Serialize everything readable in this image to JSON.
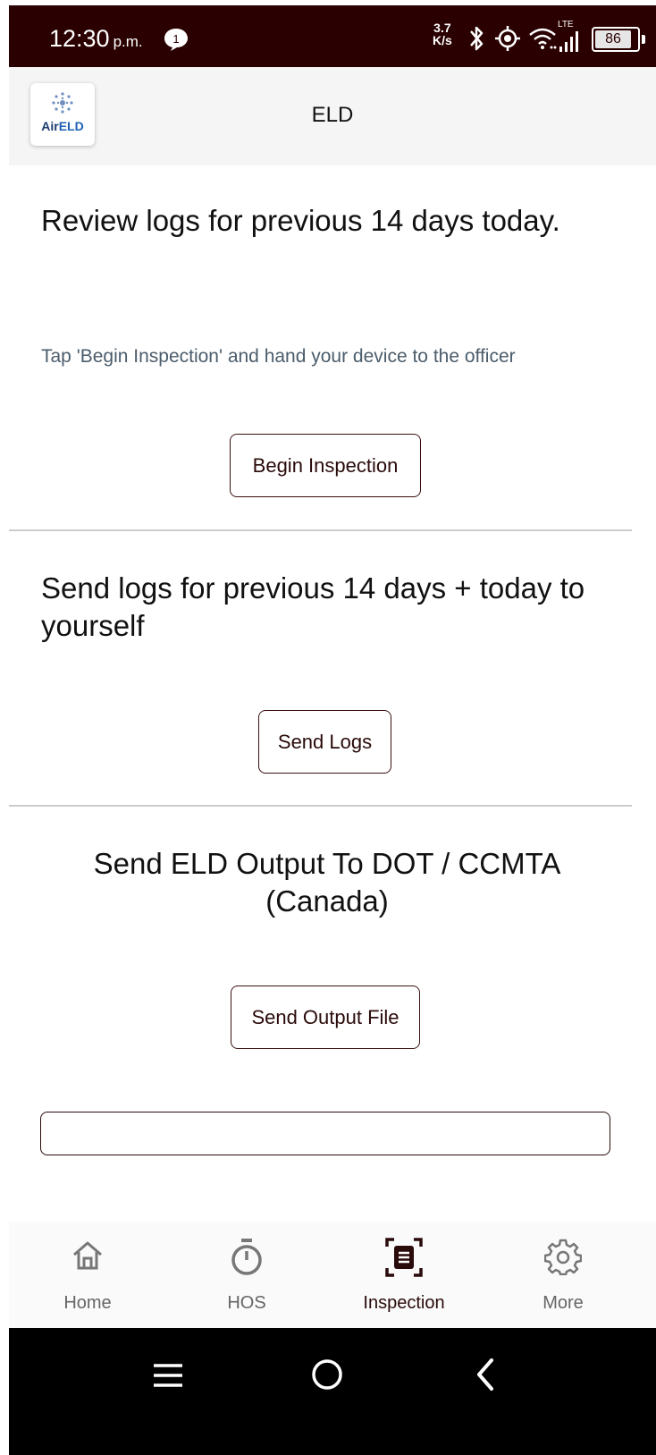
{
  "status_bar": {
    "time": "12:30",
    "ampm": "p.m.",
    "notification_count": "1",
    "net_speed_value": "3.7",
    "net_speed_unit": "K/s",
    "network_type": "LTE",
    "battery_level": "86"
  },
  "header": {
    "logo_air": "Air",
    "logo_eld": "ELD",
    "title": "ELD"
  },
  "section_review": {
    "heading": "Review logs for previous 14 days today.",
    "hint": "Tap 'Begin Inspection' and hand your device to the officer",
    "button_label": "Begin Inspection"
  },
  "section_send_logs": {
    "heading": "Send logs for previous 14 days + today to yourself",
    "button_label": "Send Logs"
  },
  "section_output": {
    "heading": "Send ELD Output To DOT / CCMTA (Canada)",
    "button_label": "Send Output File",
    "input_value": ""
  },
  "bottom_nav": {
    "items": [
      {
        "label": "Home",
        "icon": "home-icon",
        "active": false
      },
      {
        "label": "HOS",
        "icon": "timer-icon",
        "active": false
      },
      {
        "label": "Inspection",
        "icon": "inspection-icon",
        "active": true
      },
      {
        "label": "More",
        "icon": "gear-icon",
        "active": false
      }
    ]
  },
  "colors": {
    "status_bar_bg": "#2a0000",
    "accent": "#2a0a0a",
    "hint_text": "#4b5c6b",
    "inactive_nav": "#666666"
  }
}
